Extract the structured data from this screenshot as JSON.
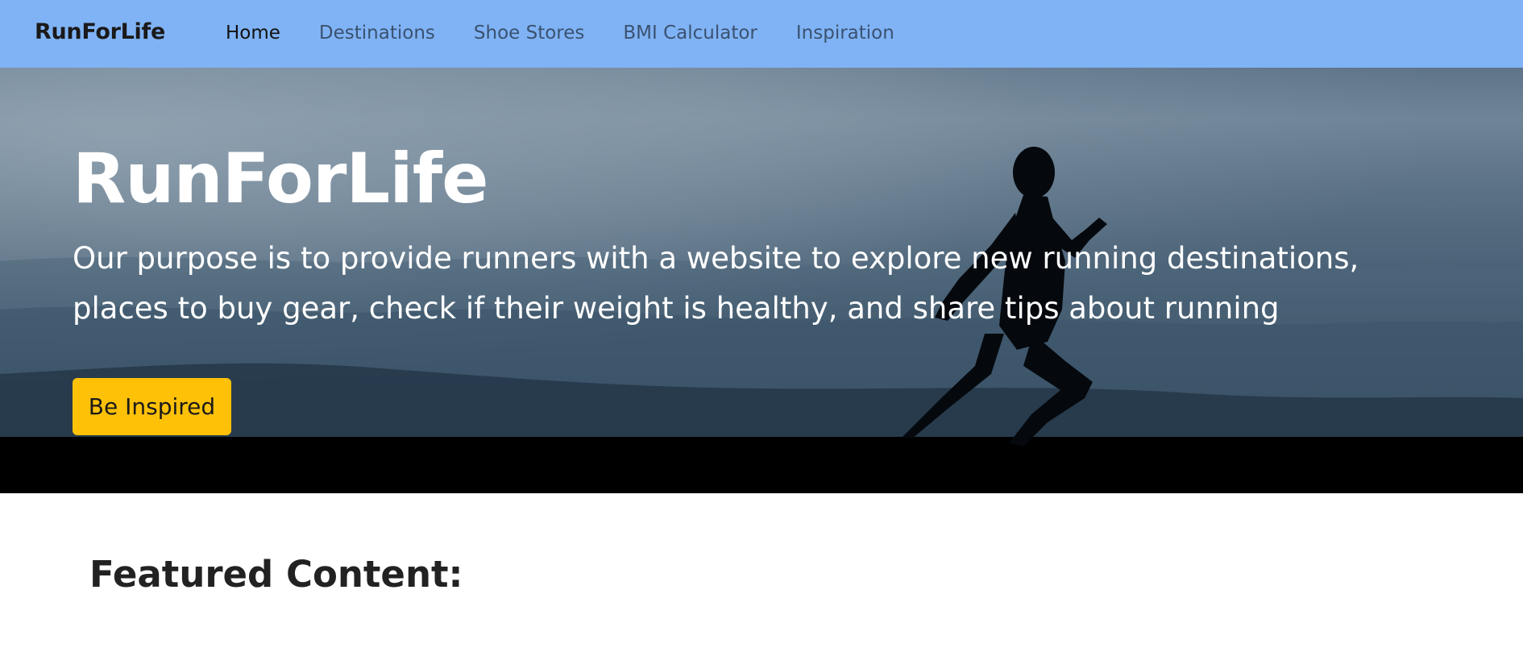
{
  "navbar": {
    "brand": "RunForLife",
    "links": [
      {
        "label": "Home",
        "active": true
      },
      {
        "label": "Destinations",
        "active": false
      },
      {
        "label": "Shoe Stores",
        "active": false
      },
      {
        "label": "BMI Calculator",
        "active": false
      },
      {
        "label": "Inspiration",
        "active": false
      }
    ],
    "background_color": "#80b3f5"
  },
  "hero": {
    "title": "RunForLife",
    "lead": "Our purpose is to provide runners with a website to explore new running destinations, places to buy gear, check if their weight is healthy, and share tips about running",
    "button_label": "Be Inspired",
    "button_color": "#ffc107",
    "background_image": "runner-silhouette-at-dusk"
  },
  "featured": {
    "heading": "Featured Content:"
  }
}
